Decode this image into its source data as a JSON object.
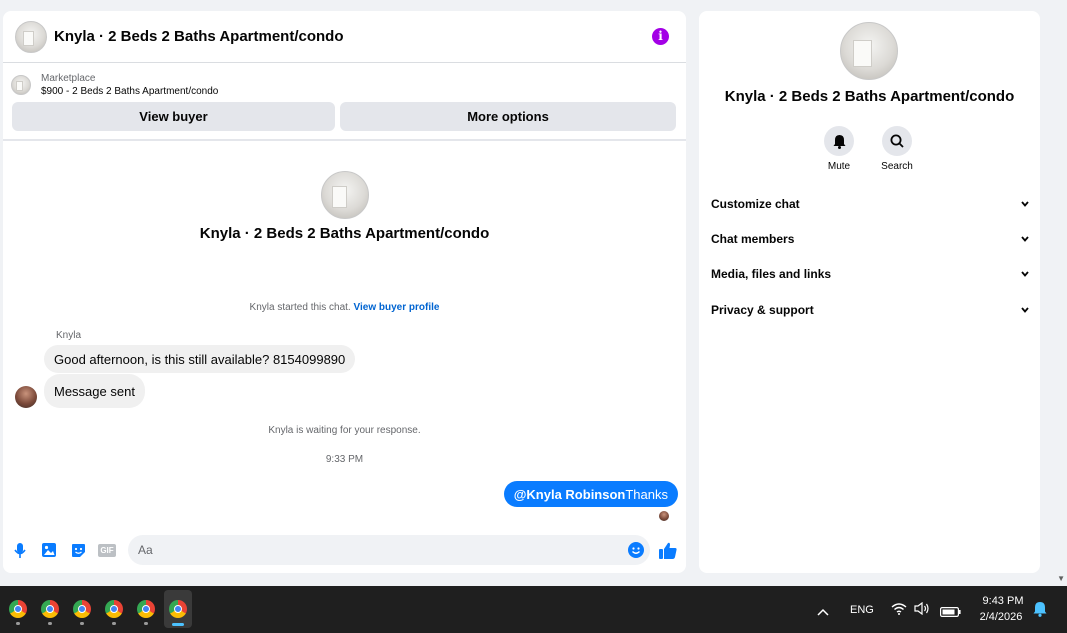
{
  "chat": {
    "header_title": "Knyla · 2 Beds 2 Baths Apartment/condo",
    "info_icon": "i",
    "marketplace_label": "Marketplace",
    "listing_line": "$900 - 2 Beds 2 Baths Apartment/condo",
    "view_buyer_label": "View buyer",
    "more_options_label": "More options",
    "intro_title": "Knyla · 2 Beds 2 Baths Apartment/condo",
    "started_text": "Knyla started this chat.",
    "view_buyer_profile": "View buyer profile",
    "sender_name": "Knyla",
    "msg1": "Good afternoon, is this still available? 8154099890",
    "msg2": "Message sent",
    "waiting_text": "Knyla is waiting for your response.",
    "timestamp": "9:33 PM",
    "out_mention": "@Knyla Robinson",
    "out_text": "Thanks",
    "input_placeholder": "Aa",
    "gif_label": "GIF"
  },
  "info_panel": {
    "title": "Knyla · 2 Beds 2 Baths Apartment/condo",
    "mute_label": "Mute",
    "search_label": "Search",
    "sections": [
      "Customize chat",
      "Chat members",
      "Media, files and links",
      "Privacy & support"
    ]
  },
  "taskbar": {
    "language": "ENG",
    "time": "9:43 PM",
    "date": "2/4/2026"
  },
  "colors": {
    "accent_blue": "#0a7cff",
    "info_purple": "#a300e6",
    "link_blue": "#0064d1"
  }
}
